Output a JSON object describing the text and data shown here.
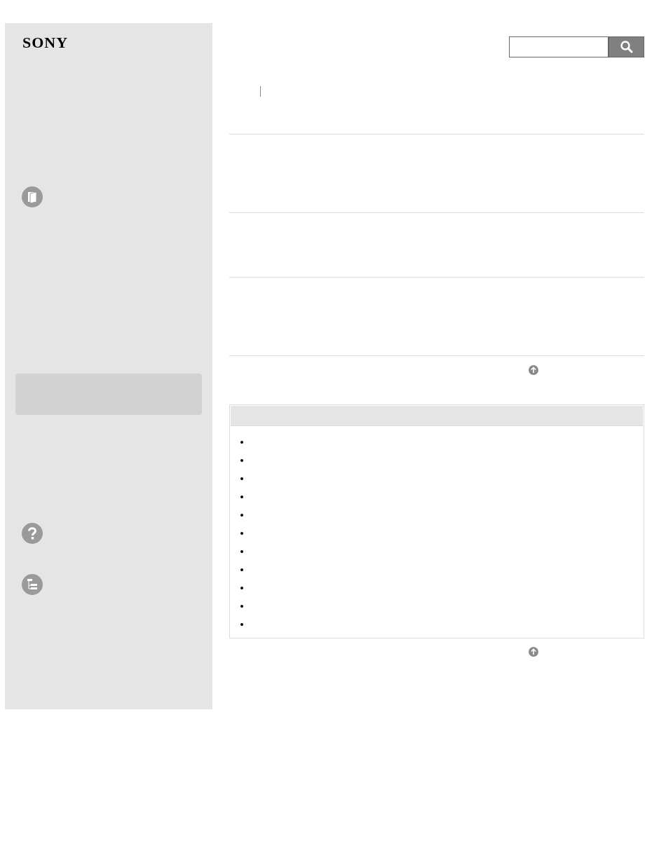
{
  "logo": "SONY",
  "sidebar": {
    "items": [
      {
        "kind": "book"
      },
      {
        "kind": "panel"
      },
      {
        "kind": "help"
      },
      {
        "kind": "tree"
      }
    ]
  },
  "related_list": {
    "items": [
      {
        "kind": "bullet"
      },
      {
        "kind": "bullet"
      },
      {
        "kind": "bullet"
      },
      {
        "kind": "bullet"
      },
      {
        "kind": "bullet"
      },
      {
        "kind": "bullet"
      },
      {
        "kind": "bullet"
      },
      {
        "kind": "bullet"
      },
      {
        "kind": "bullet"
      },
      {
        "kind": "bullet"
      },
      {
        "kind": "bullet"
      }
    ]
  }
}
